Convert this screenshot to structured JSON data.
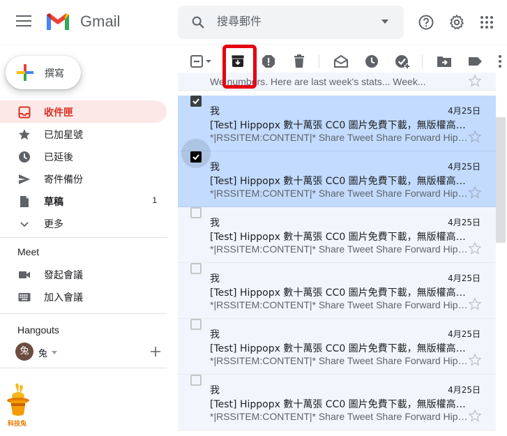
{
  "app": {
    "logo_text": "Gmail"
  },
  "search": {
    "placeholder": "搜尋郵件"
  },
  "compose": {
    "label": "撰寫"
  },
  "nav": [
    {
      "label": "收件匣",
      "icon": "inbox-icon",
      "count": "",
      "active": true
    },
    {
      "label": "已加星號",
      "icon": "star-icon",
      "count": ""
    },
    {
      "label": "已延後",
      "icon": "clock-icon",
      "count": ""
    },
    {
      "label": "寄件備份",
      "icon": "send-icon",
      "count": ""
    },
    {
      "label": "草稿",
      "icon": "draft-icon",
      "count": "1"
    },
    {
      "label": "更多",
      "icon": "chevron-down-icon",
      "count": ""
    }
  ],
  "meet": {
    "title": "Meet",
    "items": [
      {
        "label": "發起會議",
        "icon": "video-icon"
      },
      {
        "label": "加入會議",
        "icon": "keyboard-icon"
      }
    ]
  },
  "hangouts": {
    "title": "Hangouts",
    "user_initial": "兔",
    "user_name": "兔"
  },
  "watermark": {
    "text": "科技兔"
  },
  "list": {
    "partial_snippet": "We      numbers. Here are last week's stats... Week...",
    "rows": [
      {
        "sender": "我",
        "date": "4月25日",
        "subject": "[Test] Hippopx 數十萬張 CC0 圖片免費下載，無版權高畫質",
        "snippet": "*|RSSITEM:CONTENT|* Share Tweet Share Forward Hippopx",
        "selected": true
      },
      {
        "sender": "我",
        "date": "4月25日",
        "subject": "[Test] Hippopx 數十萬張 CC0 圖片免費下載，無版權高畫質",
        "snippet": "*|RSSITEM:CONTENT|* Share Tweet Share Forward Hippopx",
        "selected": true
      },
      {
        "sender": "我",
        "date": "4月25日",
        "subject": "[Test] Hippopx 數十萬張 CC0 圖片免費下載，無版權高畫質",
        "snippet": "*|RSSITEM:CONTENT|* Share Tweet Share Forward Hippopx",
        "selected": false
      },
      {
        "sender": "我",
        "date": "4月25日",
        "subject": "[Test] Hippopx 數十萬張 CC0 圖片免費下載，無版權高畫質",
        "snippet": "*|RSSITEM:CONTENT|* Share Tweet Share Forward Hippopx",
        "selected": false
      },
      {
        "sender": "我",
        "date": "4月25日",
        "subject": "[Test] Hippopx 數十萬張 CC0 圖片免費下載，無版權高畫質",
        "snippet": "*|RSSITEM:CONTENT|* Share Tweet Share Forward Hippopx",
        "selected": false
      },
      {
        "sender": "我",
        "date": "4月25日",
        "subject": "[Test] Hippopx 數十萬張 CC0 圖片免費下載，無版權高畫質",
        "snippet": "*|RSSITEM:CONTENT|* Share Tweet Share Forward Hippopx",
        "selected": false
      }
    ]
  },
  "colors": {
    "accent_red": "#d93025",
    "selected_row": "#c2dbff",
    "highlight_box": "#e60012"
  }
}
